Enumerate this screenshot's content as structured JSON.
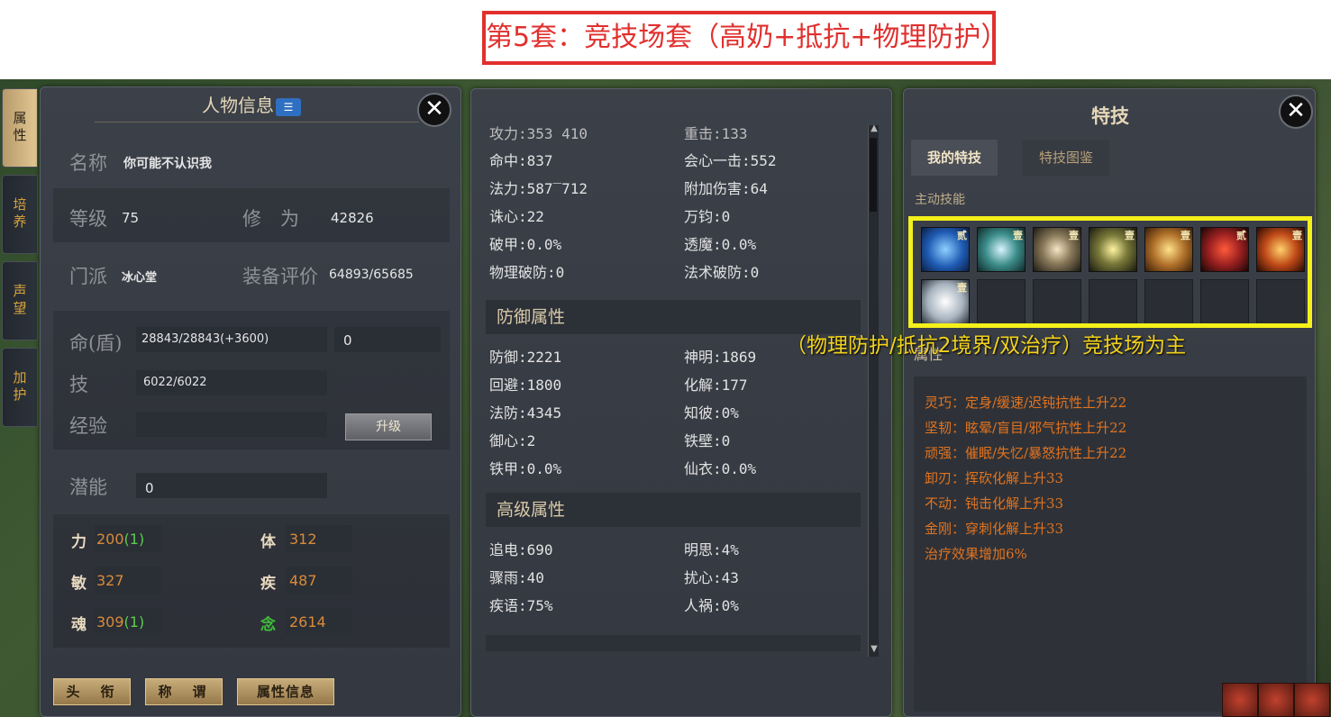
{
  "banner": {
    "text": "第5套：竞技场套（高奶+抵抗+物理防护）"
  },
  "vtabs": [
    "属性",
    "培养",
    "声望",
    "加护"
  ],
  "character": {
    "title": "人物信息",
    "name_label": "名称",
    "name_value": "你可能不认识我",
    "level_label": "等级",
    "level_value": "75",
    "cultivation_label": "修　为",
    "cultivation_value": "42826",
    "sect_label": "门派",
    "sect_value": "冰心堂",
    "equip_label": "装备评价",
    "equip_value": "64893/65685",
    "hp_label": "命(盾)",
    "hp_value": "28843/28843(+3600)",
    "hp_extra": "0",
    "skill_label": "技",
    "skill_value": "6022/6022",
    "exp_label": "经验",
    "exp_value": "",
    "upgrade_button": "升级",
    "potential_label": "潜能",
    "potential_value": "0",
    "attrs": {
      "str_label": "力",
      "str_value": "200",
      "str_plus": "(1)",
      "con_label": "体",
      "con_value": "312",
      "agi_label": "敏",
      "agi_value": "327",
      "spd_label": "疾",
      "spd_value": "487",
      "soul_label": "魂",
      "soul_value": "309",
      "soul_plus": "(1)",
      "mind_label": "念",
      "mind_value": "2614"
    },
    "buttons": [
      "头　衔",
      "称　谓",
      "属性信息"
    ]
  },
  "stats": {
    "top_cut_left": "攻力:353 410",
    "top_cut_right": "重击:133",
    "rows_top": [
      [
        "命中:837",
        "会心一击:552"
      ],
      [
        "法力:587‾712",
        "附加伤害:64"
      ],
      [
        "诛心:22",
        "万钧:0"
      ],
      [
        "破甲:0.0%",
        "透魔:0.0%"
      ],
      [
        "物理破防:0",
        "法术破防:0"
      ]
    ],
    "defense_header": "防御属性",
    "rows_defense": [
      [
        "防御:2221",
        "神明:1869"
      ],
      [
        "回避:1800",
        "化解:177"
      ],
      [
        "法防:4345",
        "知彼:0%"
      ],
      [
        "御心:2",
        "铁壁:0"
      ],
      [
        "铁甲:0.0%",
        "仙衣:0.0%"
      ]
    ],
    "advanced_header": "高级属性",
    "rows_advanced": [
      [
        "追电:690",
        "明思:4%"
      ],
      [
        "骤雨:40",
        "扰心:43"
      ],
      [
        "疾语:75%",
        "人祸:0%"
      ]
    ]
  },
  "skills": {
    "title": "特技",
    "tab_mine": "我的特技",
    "tab_book": "特技图鉴",
    "active_label": "主动技能",
    "icons": [
      {
        "name": "swirl-skill-icon",
        "tag": "贰",
        "color": "#2a6cc4"
      },
      {
        "name": "spark-skill-icon",
        "tag": "壹",
        "color": "#3b8d8a"
      },
      {
        "name": "burst-skill-icon",
        "tag": "壹",
        "color": "#8a7a5a"
      },
      {
        "name": "lightning-skill-icon",
        "tag": "壹",
        "color": "#7a7a3a"
      },
      {
        "name": "golden-skill-icon",
        "tag": "壹",
        "color": "#b0702a"
      },
      {
        "name": "flame-demon-skill-icon",
        "tag": "贰",
        "color": "#9a2020"
      },
      {
        "name": "fire-burst-skill-icon",
        "tag": "壹",
        "color": "#c04a18"
      },
      {
        "name": "shield-skill-icon",
        "tag": "壹",
        "color": "#a8b4c0"
      }
    ],
    "overlay_note": "（物理防护/抵抗2境界/双治疗）竞技场为主",
    "attr_section": "属性",
    "effects": [
      "灵巧：定身/缓速/迟钝抗性上升22",
      "坚韧：眩晕/盲目/邪气抗性上升22",
      "顽强：催眠/失忆/暴怒抗性上升22",
      "卸刃：挥砍化解上升33",
      "不动：钝击化解上升33",
      "金刚：穿刺化解上升33",
      "治疗效果增加6%"
    ]
  },
  "close_glyph": "✕"
}
